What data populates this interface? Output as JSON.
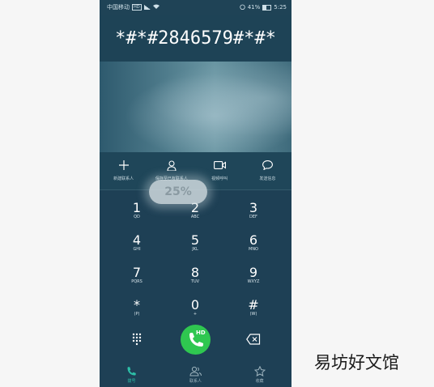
{
  "status_bar": {
    "carrier": "中国移动",
    "network_badge": "HD",
    "battery": "41%",
    "time": "5:25",
    "icons": [
      "signal-icon",
      "wifi-icon",
      "alarm-icon",
      "battery-icon"
    ]
  },
  "dialer": {
    "number": "*#*#2846579#*#*"
  },
  "actions": [
    {
      "icon": "plus-icon",
      "label": "新建联系人"
    },
    {
      "icon": "person-icon",
      "label": "保存至已有联系人"
    },
    {
      "icon": "video-call-icon",
      "label": "视频呼叫"
    },
    {
      "icon": "message-icon",
      "label": "发送信息"
    }
  ],
  "progress": {
    "value": 25,
    "label": "25%"
  },
  "keys": [
    {
      "digit": "1",
      "letters": "QD"
    },
    {
      "digit": "2",
      "letters": "ABC"
    },
    {
      "digit": "3",
      "letters": "DEF"
    },
    {
      "digit": "4",
      "letters": "GHI"
    },
    {
      "digit": "5",
      "letters": "JKL"
    },
    {
      "digit": "6",
      "letters": "MNO"
    },
    {
      "digit": "7",
      "letters": "PQRS"
    },
    {
      "digit": "8",
      "letters": "TUV"
    },
    {
      "digit": "9",
      "letters": "WXYZ"
    },
    {
      "digit": "*",
      "letters": "(P)"
    },
    {
      "digit": "0",
      "letters": "+"
    },
    {
      "digit": "#",
      "letters": "(W)"
    }
  ],
  "call_button": {
    "label": "HD"
  },
  "nav": [
    {
      "icon": "phone-icon",
      "label": "拨号",
      "active": true
    },
    {
      "icon": "contacts-icon",
      "label": "联系人",
      "active": false
    },
    {
      "icon": "star-icon",
      "label": "收藏",
      "active": false
    }
  ],
  "colors": {
    "call_green": "#2fc750",
    "active_tab": "#2dc0a8",
    "background": "#1e4055"
  },
  "watermark": "易坊好文馆"
}
